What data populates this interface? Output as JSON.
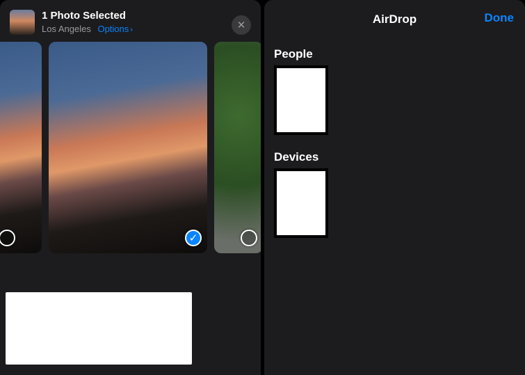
{
  "share": {
    "title": "1 Photo Selected",
    "location": "Los Angeles",
    "options_label": "Options",
    "close_icon": "close-icon",
    "thumbnails": [
      {
        "selected": false
      },
      {
        "selected": true
      },
      {
        "selected": false
      }
    ]
  },
  "airdrop": {
    "title": "AirDrop",
    "done_label": "Done",
    "sections": {
      "people_label": "People",
      "devices_label": "Devices"
    }
  },
  "colors": {
    "accent": "#0a84ff",
    "bg": "#1c1c1e",
    "muted": "#9a9aa0"
  }
}
